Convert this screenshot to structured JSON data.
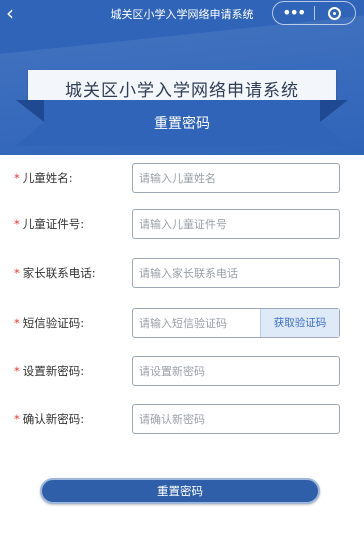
{
  "nav": {
    "back_icon": "chevron-left-icon",
    "title": "城关区小学入学网络申请系统",
    "more_icon": "more-dots-icon",
    "close_icon": "target-circle-icon"
  },
  "header": {
    "system_title": "城关区小学入学网络申请系统",
    "section_title": "重置密码"
  },
  "form": {
    "required_mark": "*",
    "fields": [
      {
        "label": "儿童姓名:",
        "placeholder": "请输入儿童姓名"
      },
      {
        "label": "儿童证件号:",
        "placeholder": "请输入儿童证件号"
      },
      {
        "label": "家长联系电话:",
        "placeholder": "请输入家长联系电话"
      },
      {
        "label": "短信验证码:",
        "placeholder": "请输入短信验证码",
        "button": "获取验证码"
      },
      {
        "label": "设置新密码:",
        "placeholder": "请设置新密码"
      },
      {
        "label": "确认新密码:",
        "placeholder": "请确认新密码"
      }
    ],
    "submit_label": "重置密码"
  },
  "colors": {
    "primary": "#2f64b9",
    "required": "#e33333",
    "button_text": "#3b6fc4"
  }
}
